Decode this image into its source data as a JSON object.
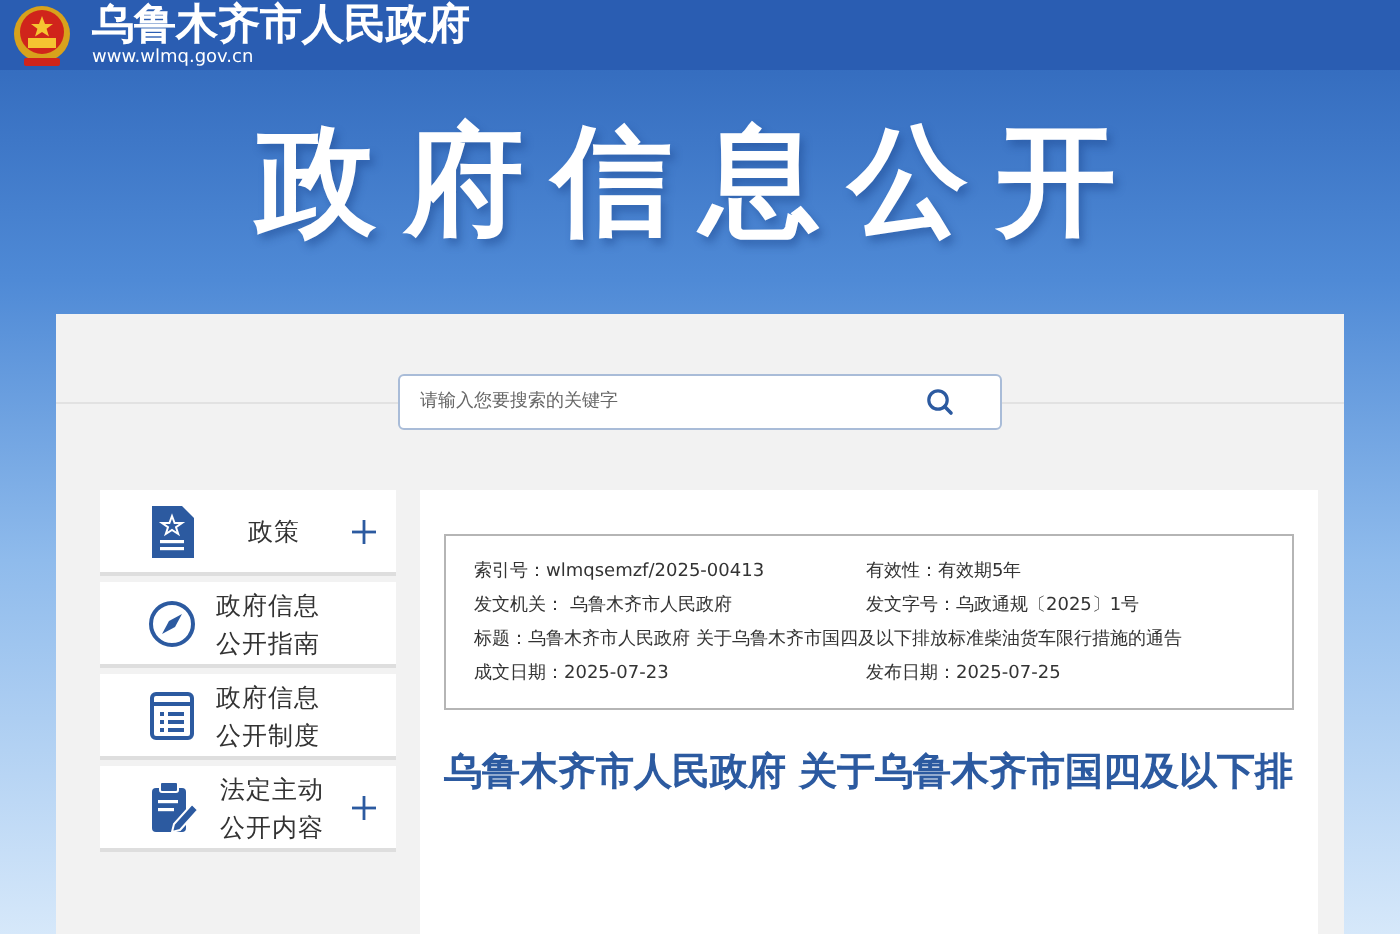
{
  "header": {
    "site_name": "乌鲁木齐市人民政府",
    "url": "www.wlmq.gov.cn"
  },
  "banner": {
    "title": "政府信息公开"
  },
  "search": {
    "placeholder": "请输入您要搜索的关键字"
  },
  "sidebar": {
    "items": [
      {
        "label": "政策",
        "kind": "document",
        "expandable": true
      },
      {
        "label": "政府信息公开指南",
        "kind": "compass",
        "expandable": false
      },
      {
        "label": "政府信息公开制度",
        "kind": "list",
        "expandable": false
      },
      {
        "label": "法定主动公开内容",
        "kind": "clipboard",
        "expandable": true
      }
    ]
  },
  "info": {
    "fields": [
      {
        "label": "索引号：",
        "value": "wlmqsemzf/2025-00413"
      },
      {
        "label": "有效性：",
        "value": "有效期5年"
      },
      {
        "label": "发文机关：",
        "value": " 乌鲁木齐市人民政府"
      },
      {
        "label": "发文字号：",
        "value": "乌政通规〔2025〕1号"
      },
      {
        "label": "标题：",
        "value": "乌鲁木齐市人民政府 关于乌鲁木齐市国四及以下排放标准柴油货车限行措施的通告",
        "wide": true
      },
      {
        "label": "成文日期：",
        "value": "2025-07-23"
      },
      {
        "label": "发布日期：",
        "value": "2025-07-25"
      }
    ]
  },
  "article": {
    "title": "乌鲁木齐市人民政府 关于乌鲁木齐市国四及以下排"
  }
}
